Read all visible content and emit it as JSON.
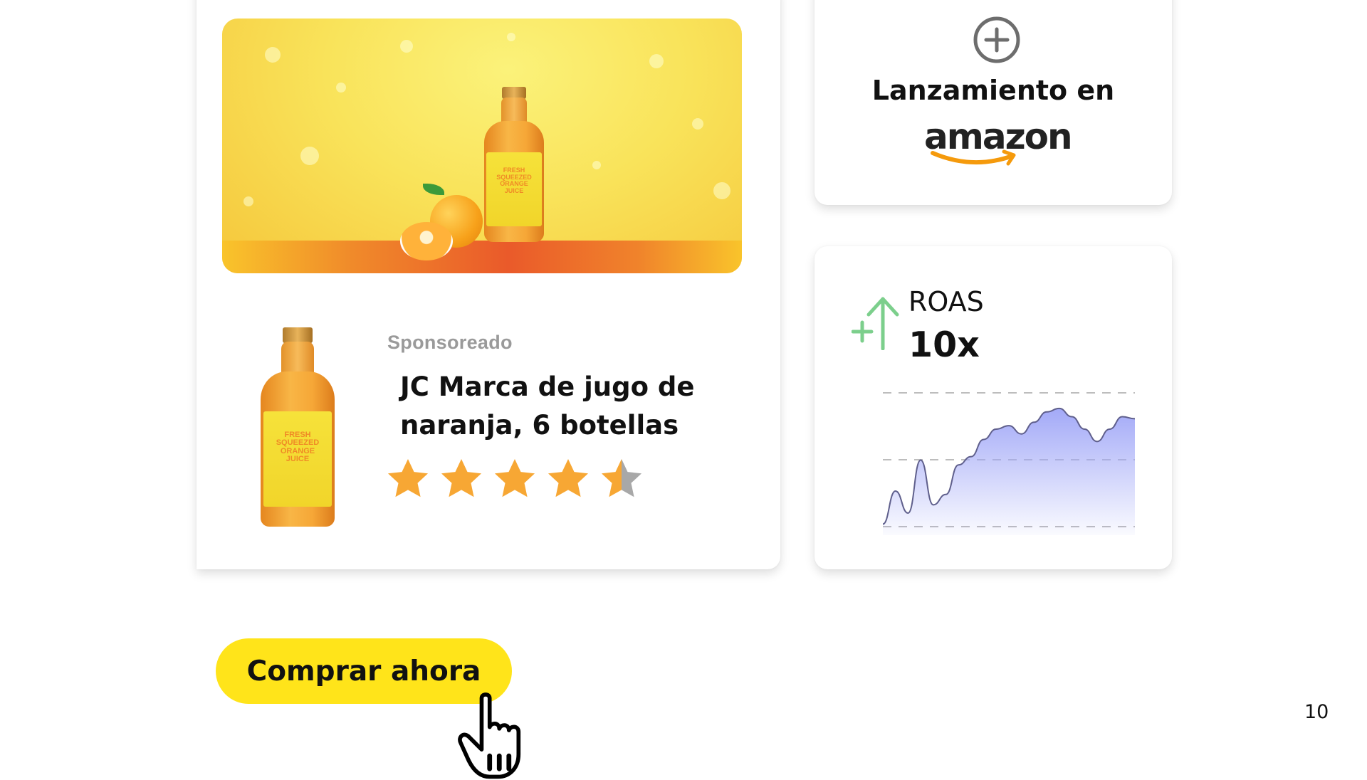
{
  "product": {
    "sponsored_label": "Sponsoreado",
    "title": "JC Marca de jugo de naranja, 6 botellas",
    "rating": {
      "value": 4.5,
      "max": 5
    },
    "bottle_label": {
      "line1": "FRESH SQUEEZED",
      "line2": "ORANGE JUICE"
    }
  },
  "cta": {
    "label": "Comprar ahora"
  },
  "launch": {
    "text": "Lanzamiento en",
    "brand": "amazon"
  },
  "roas": {
    "label": "ROAS",
    "value": "10x"
  },
  "chart_data": {
    "type": "area",
    "x": [
      0,
      1,
      2,
      3,
      4,
      5,
      6,
      7,
      8,
      9,
      10,
      11,
      12,
      13,
      14,
      15,
      16,
      17,
      18,
      19,
      20
    ],
    "values": [
      12,
      60,
      28,
      105,
      40,
      55,
      98,
      110,
      135,
      150,
      155,
      143,
      160,
      175,
      180,
      168,
      150,
      132,
      150,
      168,
      165
    ],
    "grid": true,
    "gridlines": 3
  },
  "page_number": "10",
  "colors": {
    "cta_yellow": "#ffe41a",
    "star_orange": "#f7a734",
    "star_gray": "#a8a8a8",
    "arrow_green": "#7ccf8c",
    "chart_fill": "#9ea5f7",
    "amazon_orange": "#f59a0c"
  },
  "icons": {
    "plus": "plus-circle-icon",
    "hand": "pointer-hand-icon",
    "arrow": "growth-arrow-icon"
  }
}
